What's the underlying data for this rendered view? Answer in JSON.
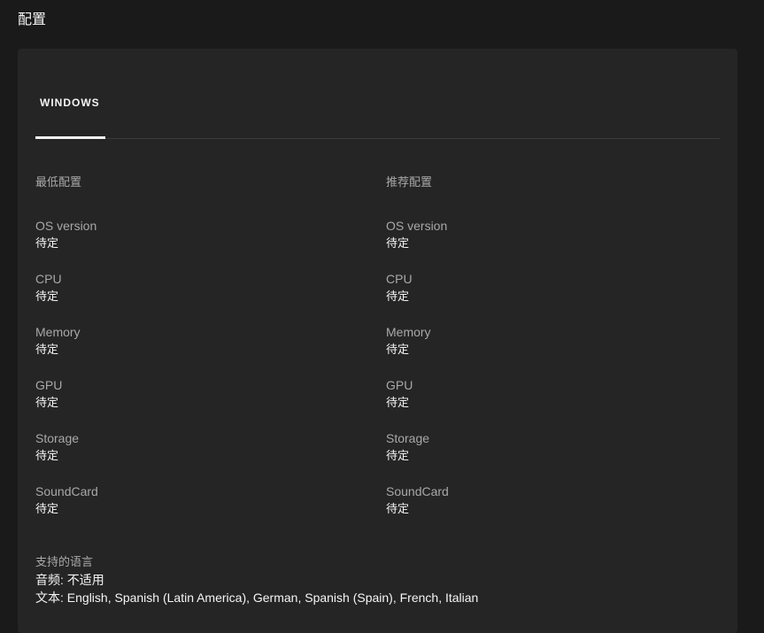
{
  "page": {
    "section_title": "配置"
  },
  "tabs": [
    {
      "label": "WINDOWS",
      "active": true
    }
  ],
  "requirements": {
    "minimum": {
      "heading": "最低配置",
      "specs": [
        {
          "label": "OS version",
          "value": "待定"
        },
        {
          "label": "CPU",
          "value": "待定"
        },
        {
          "label": "Memory",
          "value": "待定"
        },
        {
          "label": "GPU",
          "value": "待定"
        },
        {
          "label": "Storage",
          "value": "待定"
        },
        {
          "label": "SoundCard",
          "value": "待定"
        }
      ]
    },
    "recommended": {
      "heading": "推荐配置",
      "specs": [
        {
          "label": "OS version",
          "value": "待定"
        },
        {
          "label": "CPU",
          "value": "待定"
        },
        {
          "label": "Memory",
          "value": "待定"
        },
        {
          "label": "GPU",
          "value": "待定"
        },
        {
          "label": "Storage",
          "value": "待定"
        },
        {
          "label": "SoundCard",
          "value": "待定"
        }
      ]
    }
  },
  "languages": {
    "heading": "支持的语言",
    "audio": "音频: 不适用",
    "text": "文本: English, Spanish (Latin America), German, Spanish (Spain), French, Italian"
  },
  "colors": {
    "background": "#1a1a1a",
    "card": "#252525",
    "muted_text": "#a8a8a8",
    "primary_text": "#f5f5f5"
  }
}
